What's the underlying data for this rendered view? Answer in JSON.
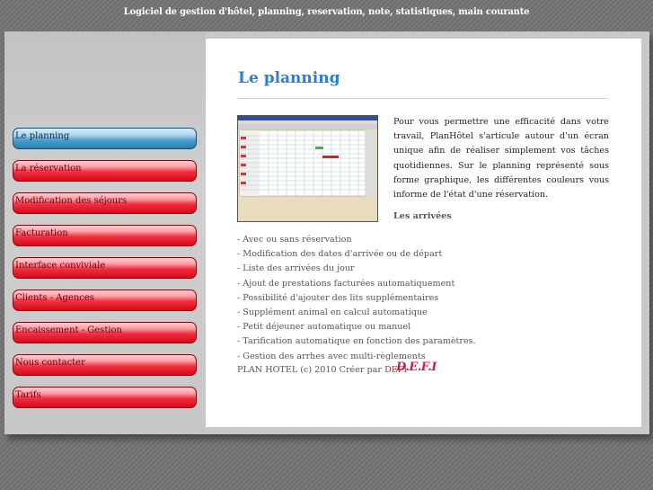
{
  "header": {
    "title": "Logiciel de gestion d'hôtel, planning, reservation, note, statistiques, main courante"
  },
  "sidebar": {
    "items": [
      {
        "label": "Le planning",
        "active": true
      },
      {
        "label": "La réservation",
        "active": false
      },
      {
        "label": "Modification des séjours",
        "active": false
      },
      {
        "label": "Facturation",
        "active": false
      },
      {
        "label": "Interface conviviale",
        "active": false
      },
      {
        "label": "Clients - Agences",
        "active": false
      },
      {
        "label": "Encaissement - Gestion",
        "active": false
      },
      {
        "label": "Nous contacter",
        "active": false
      },
      {
        "label": "Tarifs",
        "active": false
      }
    ]
  },
  "main": {
    "title": "Le planning",
    "intro": "Pour vous permettre une efficacité dans votre travail, PlanHôtel s'articule autour d'un écran unique afin de réaliser simplement vos tâches quotidiennes. Sur le planning représenté sous forme graphique, les différentes couleurs vous informe de l'état d'une réservation.",
    "section_title": "Les arrivées",
    "features": [
      "- Avec ou sans réservation",
      "- Modification des dates d'arrivée ou de départ",
      "- Liste des arrivées du jour",
      "- Ajout de prestations facturées automatiquement",
      "- Possibilité d'ajouter des lits supplémentaires",
      "- Supplément animal en calcul automatique",
      "- Petit déjeuner automatique ou manuel",
      "- Tarification automatique en fonction des paramètres.",
      "- Gestion des arrhes avec multi-règlements"
    ]
  },
  "footer": {
    "text": "PLAN HOTEL (c) 2010 Créer par",
    "link": "DEFI",
    "logo": "D.E.F.I"
  },
  "colors": {
    "accent": "#2a7fd4",
    "nav_active": "#4a9ccc",
    "nav_inactive": "#e01828",
    "link": "#d02030"
  }
}
